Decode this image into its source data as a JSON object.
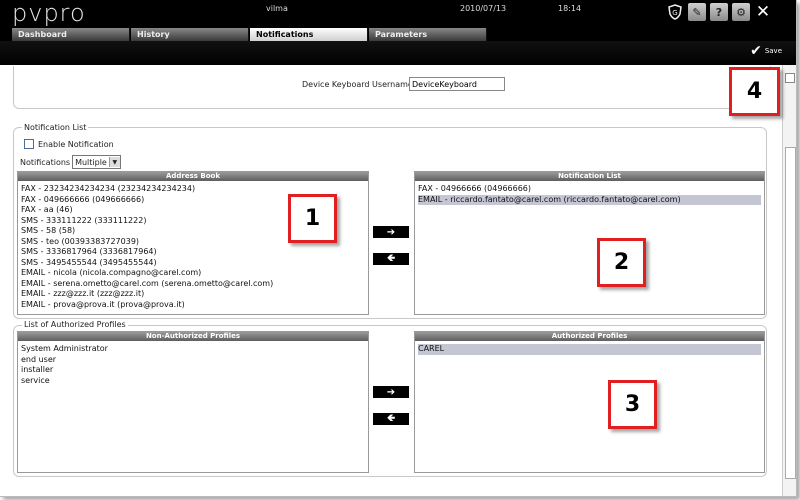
{
  "header": {
    "logo": "pvpro",
    "user": "vilma",
    "date": "2010/07/13",
    "time": "18:14"
  },
  "tabs": [
    {
      "label": "Dashboard"
    },
    {
      "label": "History"
    },
    {
      "label": "Notifications"
    },
    {
      "label": "Parameters"
    }
  ],
  "toolbar": {
    "save_label": "Save"
  },
  "device": {
    "label": "Device Keyboard Username",
    "value": "DeviceKeyboard"
  },
  "notification_list": {
    "legend": "Notification List",
    "enable_label": "Enable Notification",
    "notifications_label": "Notifications",
    "notifications_value": "Multiple",
    "address_book": {
      "title": "Address Book",
      "items": [
        "FAX - 23234234234234 (23234234234234)",
        "FAX - 049666666 (049666666)",
        "FAX - aa (46)",
        "SMS - 333111222 (333111222)",
        "SMS - 58 (58)",
        "SMS - teo (00393383727039)",
        "SMS - 3336817964 (3336817964)",
        "SMS - 3495455544 (3495455544)",
        "EMAIL - nicola (nicola.compagno@carel.com)",
        "EMAIL - serena.ometto@carel.com (serena.ometto@carel.com)",
        "EMAIL - zzz@zzz.it (zzz@zzz.it)",
        "EMAIL - prova@prova.it (prova@prova.it)"
      ]
    },
    "notification_items": {
      "title": "Notification List",
      "items": [
        "FAX - 04966666 (04966666)",
        "EMAIL - riccardo.fantato@carel.com (riccardo.fantato@carel.com)"
      ]
    }
  },
  "profiles": {
    "legend": "List of Authorized Profiles",
    "non_authorized": {
      "title": "Non-Authorized Profiles",
      "items": [
        "System Administrator",
        "end user",
        "installer",
        "service"
      ]
    },
    "authorized": {
      "title": "Authorized Profiles",
      "items": [
        "CAREL"
      ]
    }
  },
  "arrows": {
    "right": "➔",
    "left": "🡸"
  },
  "callouts": [
    "1",
    "2",
    "3",
    "4"
  ],
  "colors": {
    "callout_border": "#e02020",
    "selected_row": "#c4c6d4",
    "list_header": "#7a7a7a"
  }
}
